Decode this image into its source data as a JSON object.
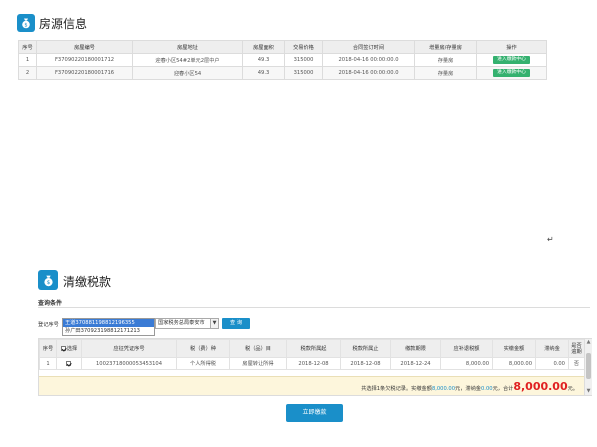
{
  "property_section": {
    "title": "房源信息",
    "columns": [
      "序号",
      "房屋编号",
      "房屋地址",
      "房屋面积",
      "交易价格",
      "合同签订时间",
      "增量房/存量房",
      "操作"
    ],
    "rows": [
      {
        "index": "1",
        "house_no": "F37090220180001712",
        "address": "迎春小区54#2单元2层中户",
        "area": "49.3",
        "price": "315000",
        "contract_time": "2018-04-16 00:00:00.0",
        "type": "存量房",
        "action": "进入缴款中心"
      },
      {
        "index": "2",
        "house_no": "F37090220180001716",
        "address": "迎春小区54",
        "area": "49.3",
        "price": "315000",
        "contract_time": "2018-04-16 00:00:00.0",
        "type": "存量房",
        "action": "进入缴款中心"
      }
    ]
  },
  "cursor_mark": "↵",
  "tax_section": {
    "title": "清缴税款",
    "query_title": "查询条件",
    "reg_no_label": "登记序号",
    "id_options": [
      "王道370881198812196355",
      "孙广田370923198812171213"
    ],
    "tax_office": "国家税务总局泰安市",
    "query_button": "查 询",
    "columns": [
      "序号",
      "选择",
      "应征凭证序号",
      "税（费）种",
      "税（品）目",
      "税款所属起",
      "税款所属止",
      "缴款期限",
      "应补退税额",
      "实缴金额",
      "滞纳金",
      "是否逾期"
    ],
    "select_all_label": "选择",
    "rows": [
      {
        "index": "1",
        "checked": true,
        "voucher_no": "10023718000053453104",
        "tax_type": "个人所得税",
        "tax_item": "房屋转让所得",
        "period_start": "2018-12-08",
        "period_end": "2018-12-08",
        "due_date": "2018-12-24",
        "amount_due": "8,000.00",
        "paid": "8,000.00",
        "late_fee": "0.00",
        "overdue": "否"
      }
    ],
    "summary": {
      "prefix": "共选择1条欠税记录。实缴金额",
      "paid_amount": "8,000.00",
      "mid1": "元，滞纳金",
      "late_amount": "0.00",
      "mid2": "元，合计",
      "total": "8,000.00",
      "suffix": "元。"
    },
    "pay_button": "立即缴款"
  },
  "colors": {
    "accent": "#1a8fc9",
    "action_green": "#34b16f",
    "total_red": "#e02020",
    "summary_bg": "#fdf6dc"
  }
}
